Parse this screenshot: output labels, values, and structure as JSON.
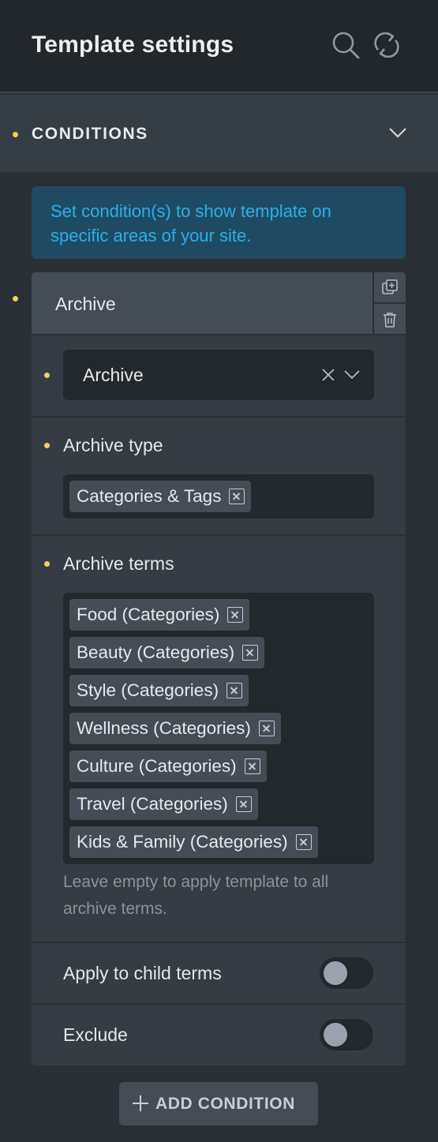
{
  "header": {
    "title": "Template settings",
    "icons": [
      "search-icon",
      "refresh-icon"
    ]
  },
  "section": {
    "label": "CONDITIONS",
    "icon": "chevron-down-icon"
  },
  "info": {
    "text": "Set condition(s) to show template on specific areas of your site."
  },
  "condition": {
    "name": "Archive",
    "actions": [
      "duplicate-icon",
      "trash-icon"
    ],
    "main_select": {
      "value": "Archive"
    },
    "archive_type": {
      "label": "Archive type",
      "tags": [
        "Categories & Tags"
      ]
    },
    "archive_terms": {
      "label": "Archive terms",
      "tags": [
        "Food (Categories)",
        "Beauty (Categories)",
        "Style (Categories)",
        "Wellness (Categories)",
        "Culture (Categories)",
        "Travel (Categories)",
        "Kids & Family (Categories)"
      ],
      "hint": "Leave empty to apply template to all archive terms."
    },
    "apply_child": {
      "label": "Apply to child terms",
      "enabled": false
    },
    "exclude": {
      "label": "Exclude",
      "enabled": false
    }
  },
  "add_button": {
    "label": "ADD CONDITION"
  },
  "colors": {
    "accent_dot": "#f5d04d",
    "info_bg": "#1f4b62",
    "info_text": "#27b1ee"
  }
}
